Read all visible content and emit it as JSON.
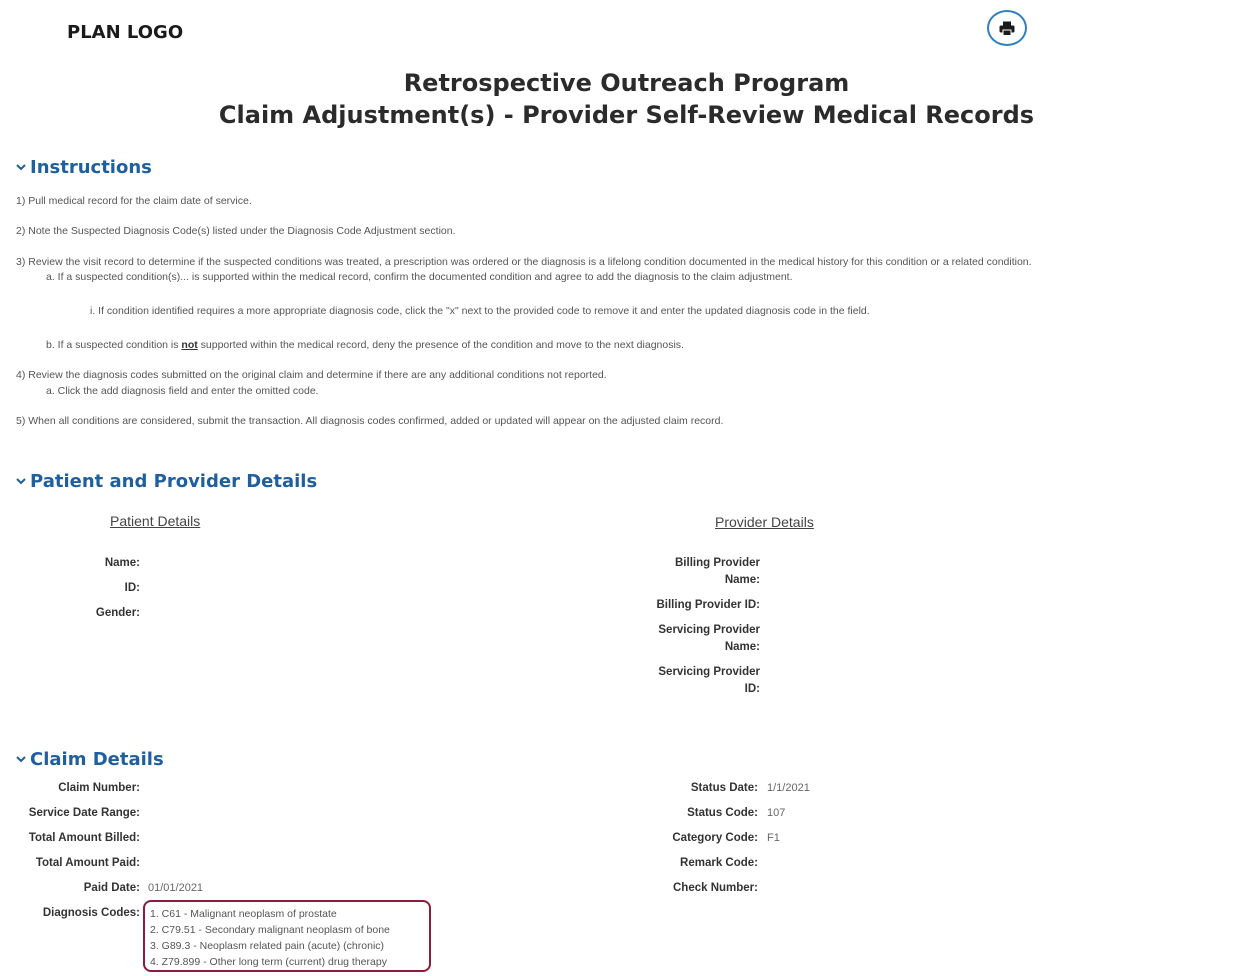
{
  "header": {
    "logo": "PLAN LOGO"
  },
  "icons": {
    "print": "printer-icon",
    "chevron": "chevron-down-icon"
  },
  "title": {
    "line1": "Retrospective Outreach Program",
    "line2": "Claim Adjustment(s) - Provider Self-Review Medical Records"
  },
  "instructions": {
    "heading": "Instructions",
    "step1": "1)  Pull medical record for the claim date of service.",
    "step2": "2)  Note the Suspected Diagnosis Code(s) listed under the Diagnosis Code Adjustment section.",
    "step3": "3)  Review the visit record to determine if the suspected conditions was treated, a prescription was ordered or the diagnosis is a lifelong condition documented in the medical history for this condition or a related condition.",
    "step3a": "a.  If a suspected condition(s)... is supported within the medical record, confirm the documented condition and agree to add the diagnosis to the claim adjustment.",
    "step3ai": "i.      If condition identified requires a more appropriate diagnosis code, click the \"x\" next to the provided code to remove it and enter the updated diagnosis code in the field.",
    "step3b_pre": "b.  If a suspected condition is ",
    "step3b_not": "not",
    "step3b_post": " supported within the medical record, deny the presence of the condition and move to the next diagnosis.",
    "step4": "4)  Review the diagnosis codes submitted on the original claim and determine if there are any additional conditions not reported.",
    "step4a": "a.  Click the add diagnosis field and enter the omitted code.",
    "step5": "5)  When all conditions are considered, submit the transaction.  All diagnosis codes confirmed, added or updated will appear on the adjusted claim record."
  },
  "patient_provider": {
    "heading": "Patient and Provider Details",
    "patient_heading": "Patient Details",
    "provider_heading": "Provider Details",
    "patient_labels": {
      "name": "Name:",
      "id": "ID:",
      "gender": "Gender:"
    },
    "provider_labels": {
      "billing_name_1": "Billing Provider",
      "billing_name_2": "Name:",
      "billing_id": "Billing Provider ID:",
      "servicing_name_1": "Servicing Provider",
      "servicing_name_2": "Name:",
      "servicing_id_1": "Servicing Provider",
      "servicing_id_2": "ID:"
    }
  },
  "claim": {
    "heading": "Claim Details",
    "labels": {
      "claim_number": "Claim Number:",
      "service_date_range": "Service Date Range:",
      "total_billed": "Total Amount Billed:",
      "total_paid": "Total Amount Paid:",
      "paid_date": "Paid Date:",
      "diagnosis_codes": "Diagnosis Codes:",
      "status_date": "Status Date:",
      "status_code": "Status Code:",
      "category_code": "Category Code:",
      "remark_code": "Remark Code:",
      "check_number": "Check Number:"
    },
    "values": {
      "paid_date": "01/01/2021",
      "status_date": "1/1/2021",
      "status_code": "107",
      "category_code": "F1"
    },
    "diagnosis_codes": [
      "1. C61 - Malignant neoplasm of prostate",
      "2. C79.51 - Secondary malignant neoplasm of bone",
      "3. G89.3 - Neoplasm related pain (acute) (chronic)",
      "4. Z79.899 - Other long term (current) drug therapy"
    ]
  }
}
